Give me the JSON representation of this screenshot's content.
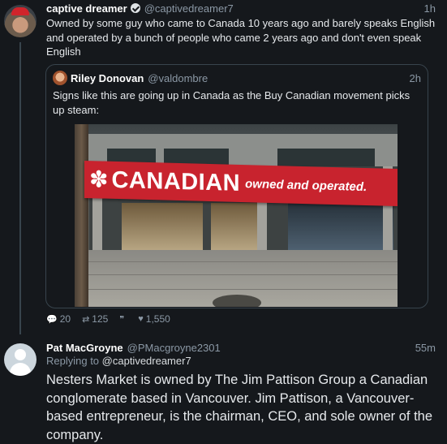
{
  "tweet": {
    "name": "captive dreamer",
    "handle": "@captivedreamer7",
    "time": "1h",
    "text": "Owned by some guy who came to Canada 10 years ago and barely speaks English and operated by a bunch of people who came 2 years ago and don't even speak English",
    "quote": {
      "name": "Riley Donovan",
      "handle": "@valdombre",
      "time": "2h",
      "text": "Signs like this are going up in Canada as the Buy Canadian movement picks up steam:",
      "banner_big": "CANADIAN",
      "banner_small": "owned and operated."
    },
    "stats": {
      "replies": "20",
      "retweets": "125",
      "quotes": "",
      "likes": "1,550"
    }
  },
  "reply": {
    "name": "Pat MacGroyne",
    "handle": "@PMacgroyne2301",
    "time": "55m",
    "replying_prefix": "Replying to ",
    "replying_handle": "@captivedreamer7",
    "text": "Nesters Market is owned by The Jim Pattison Group a Canadian conglomerate based in Vancouver. Jim Pattison, a Vancouver-based entrepreneur, is the chairman, CEO, and sole owner of the company."
  },
  "icons": {
    "reply": "comment-icon",
    "retweet": "retweet-icon",
    "quote": "quote-icon",
    "like": "heart-icon",
    "verified": "verified-badge-icon",
    "leaf": "maple-leaf-icon"
  },
  "colors": {
    "background": "#15181c",
    "banner": "#c8232e",
    "muted": "#8b98a5"
  }
}
